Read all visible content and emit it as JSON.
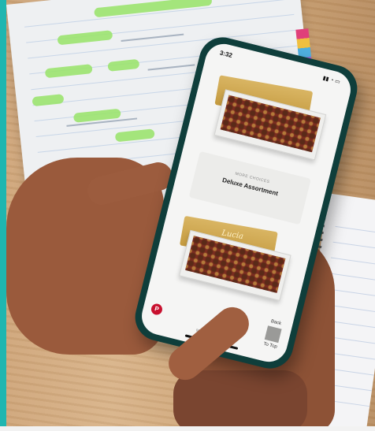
{
  "phone": {
    "status_time": "3:32",
    "products": [
      {
        "name": "Deluxe Assortment",
        "kicker": "MORE CHOICES",
        "lid_label": ""
      },
      {
        "name": "",
        "kicker": "",
        "lid_label": "Lucia"
      }
    ],
    "bottom_label": "MORE CHOICES",
    "back_to_top": [
      "Back",
      "To Top"
    ],
    "fab_icon": "pinterest-icon"
  },
  "colors": {
    "phone_case": "#0f3e3b",
    "accent_red": "#c8102e",
    "frame": "#1fb6b0"
  }
}
